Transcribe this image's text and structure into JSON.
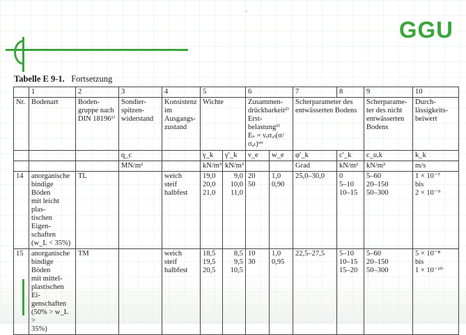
{
  "logo": "GGU",
  "caption": {
    "number": "Tabelle E 9-1.",
    "suffix": "Fortsetzung"
  },
  "table": {
    "col_numbers": [
      "",
      "1",
      "2",
      "3",
      "4",
      "5",
      "",
      "6",
      "",
      "7",
      "8",
      "9",
      "10"
    ],
    "header": {
      "nr": "Nr.",
      "c1": "Bodenart",
      "c2": "Boden-\ngruppe nach\nDIN 18196¹⁾",
      "c3": "Sondier-\nspitzen-\nwiderstand",
      "c4": "Konsistenz\nim\nAusgangs-\nzustand",
      "c5": "Wichte",
      "c6": "Zusammen-\ndrückbarkeit²⁾\nErst-\nbelastung³⁾\nEₛ = νₑσₐₜ(σ/σₐₜ)ʷᵉ",
      "c7": "Scherparameter des\nentwässerten Bodens",
      "c9": "Scherparame-\nter des nicht\nentwässerten\nBodens",
      "c10": "Durch-\nlässigkeits-\nbeiwert"
    },
    "symbols": {
      "c3": "q_c",
      "c5a": "γ_k",
      "c5b": "γ′_k",
      "c6a": "ν_e",
      "c6b": "w_e",
      "c7": "φ′_k",
      "c8": "c′_k",
      "c9": "c_u,k",
      "c10": "k_k"
    },
    "units": {
      "c3": "MN/m²",
      "c5a": "kN/m³",
      "c5b": "kN/m³",
      "c7": "Grad",
      "c8": "kN/m²",
      "c9": "kN/m²",
      "c10": "m/s"
    },
    "rows": [
      {
        "nr": "14",
        "bodenart": "anorganische\nbindige Böden\nmit leicht plas-\ntischen Eigen-\nschaften\n(w_L < 35%)",
        "gruppe": "TL",
        "sondier": "",
        "konsistenz": "weich\nsteif\nhalbfest",
        "gamma": "19,0\n20,0\n21,0",
        "gamma_p": "9,0\n10,0\n11,0",
        "ve": "20\n50",
        "we": "1,0\n0,90",
        "phi": "25,0–30,0",
        "c": "0\n5–10\n10–15",
        "cu": "5–60\n20–150\n50–300",
        "k": "1 × 10⁻⁷\nbis\n2 × 10⁻⁹"
      },
      {
        "nr": "15",
        "bodenart": "anorganische\nbindige Böden\nmit mittel-\nplastischen Ei-\ngenschaften\n(50% > w_L >\n35%)",
        "gruppe": "TM",
        "sondier": "",
        "konsistenz": "weich\nsteif\nhalbfest",
        "gamma": "18,5\n19,5\n20,5",
        "gamma_p": "8,5\n9,5\n10,5",
        "ve": "10\n30",
        "we": "1,0\n0,95",
        "phi": "22,5–27,5",
        "c": "5–10\n10–15\n15–20",
        "cu": "5–60\n20–150\n50–300",
        "k": "5 × 10⁻⁸\nbis\n1 × 10⁻¹⁰"
      }
    ]
  }
}
